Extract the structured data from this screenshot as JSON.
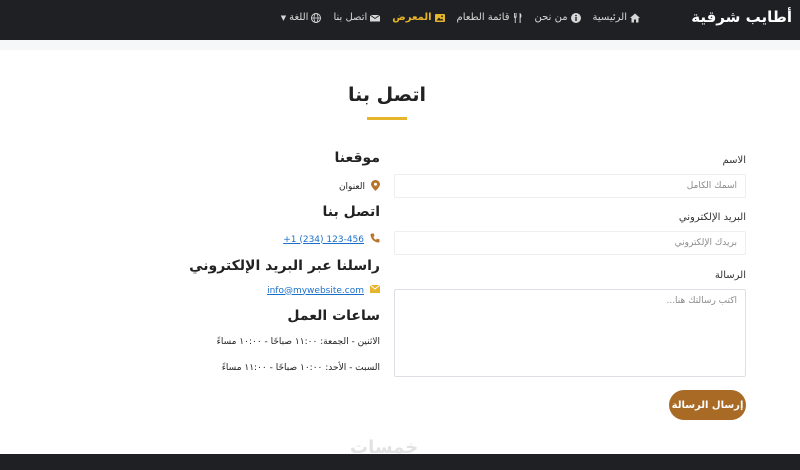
{
  "navbar": {
    "brand": "أطايب شرقية",
    "items": [
      {
        "label": "الرئيسية",
        "icon": "home-icon"
      },
      {
        "label": "من نحن",
        "icon": "info-circle-icon"
      },
      {
        "label": "قائمة الطعام",
        "icon": "utensils-icon"
      },
      {
        "label": "المعرض",
        "icon": "image-icon",
        "active": true
      },
      {
        "label": "اتصل بنا",
        "icon": "envelope-icon"
      },
      {
        "label": "اللغة",
        "icon": "globe-icon"
      }
    ],
    "accent_color": "#e7b52c"
  },
  "page": {
    "title": "اتصل بنا"
  },
  "info": {
    "location_heading": "موقعنا",
    "address": "العنوان",
    "call_heading": "اتصل بنا",
    "phone": "+1 (234) 123-456",
    "email_heading": "راسلنا عبر البريد الإلكتروني",
    "email": "info@mywebsite.com",
    "hours_heading": "ساعات العمل",
    "hours_weekdays": "الاثنين - الجمعة: ١١:٠٠ صباحًا - ١٠:٠٠ مساءً",
    "hours_weekend": "السبت - الأحد: ١٠:٠٠ صباحًا - ١١:٠٠ مساءً"
  },
  "form": {
    "name_label": "الاسم",
    "name_placeholder": "اسمك الكامل",
    "email_label": "البريد الإلكتروني",
    "email_placeholder": "بريدك الإلكتروني",
    "message_label": "الرسالة",
    "message_placeholder": "اكتب رسالتك هنا...",
    "submit_label": "إرسال الرسالة",
    "button_color": "#a86a25"
  },
  "watermark": "خمسات"
}
